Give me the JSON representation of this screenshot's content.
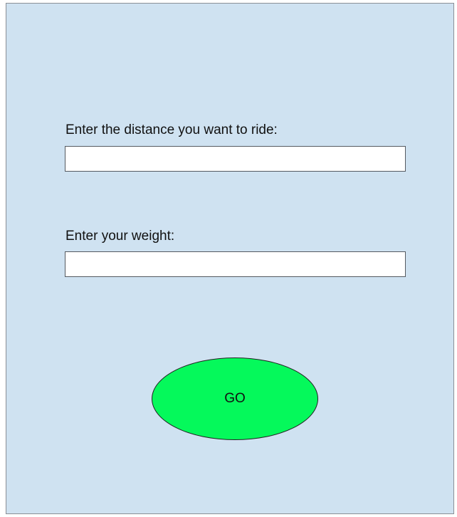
{
  "form": {
    "distance_label": "Enter the distance you want to ride:",
    "distance_value": "",
    "weight_label": "Enter your weight:",
    "weight_value": "",
    "go_label": "GO"
  },
  "colors": {
    "background": "#cfe2f1",
    "go_button": "#05f95b"
  }
}
